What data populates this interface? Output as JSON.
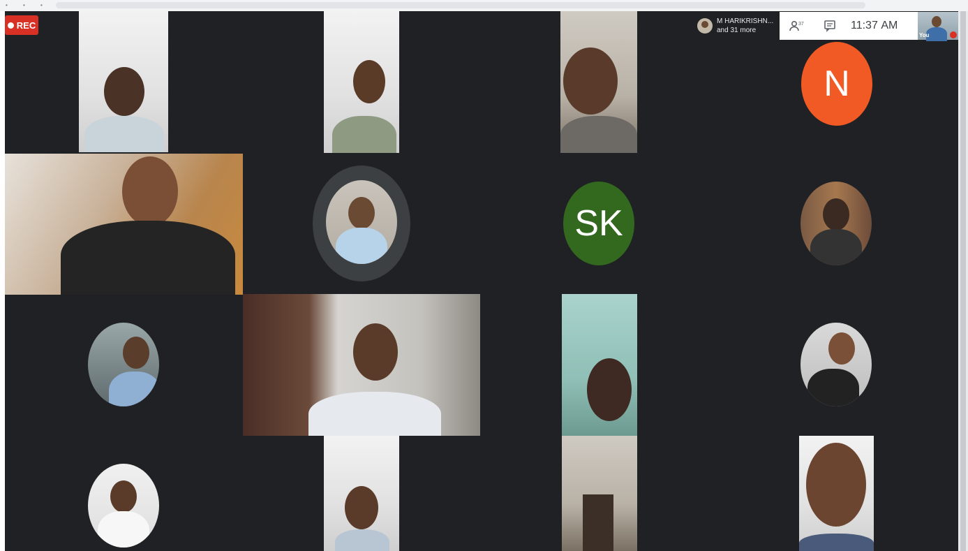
{
  "recording": {
    "label": "REC"
  },
  "top_bar": {
    "participants_summary_line1": "M HARIKRISHN...",
    "participants_summary_line2": "and 31 more",
    "people_icon": "people-icon",
    "chat_icon": "chat-icon",
    "time": "11:37",
    "time_period": "AM",
    "self_label": "You"
  },
  "avatars": [
    {
      "id": "n",
      "letter": "N",
      "color": "#f15a24"
    },
    {
      "id": "sk",
      "letter": "SK",
      "color": "#33691e"
    }
  ],
  "colors": {
    "background": "#202124",
    "rec": "#d93025",
    "speaking_ring": "#3c4043"
  }
}
